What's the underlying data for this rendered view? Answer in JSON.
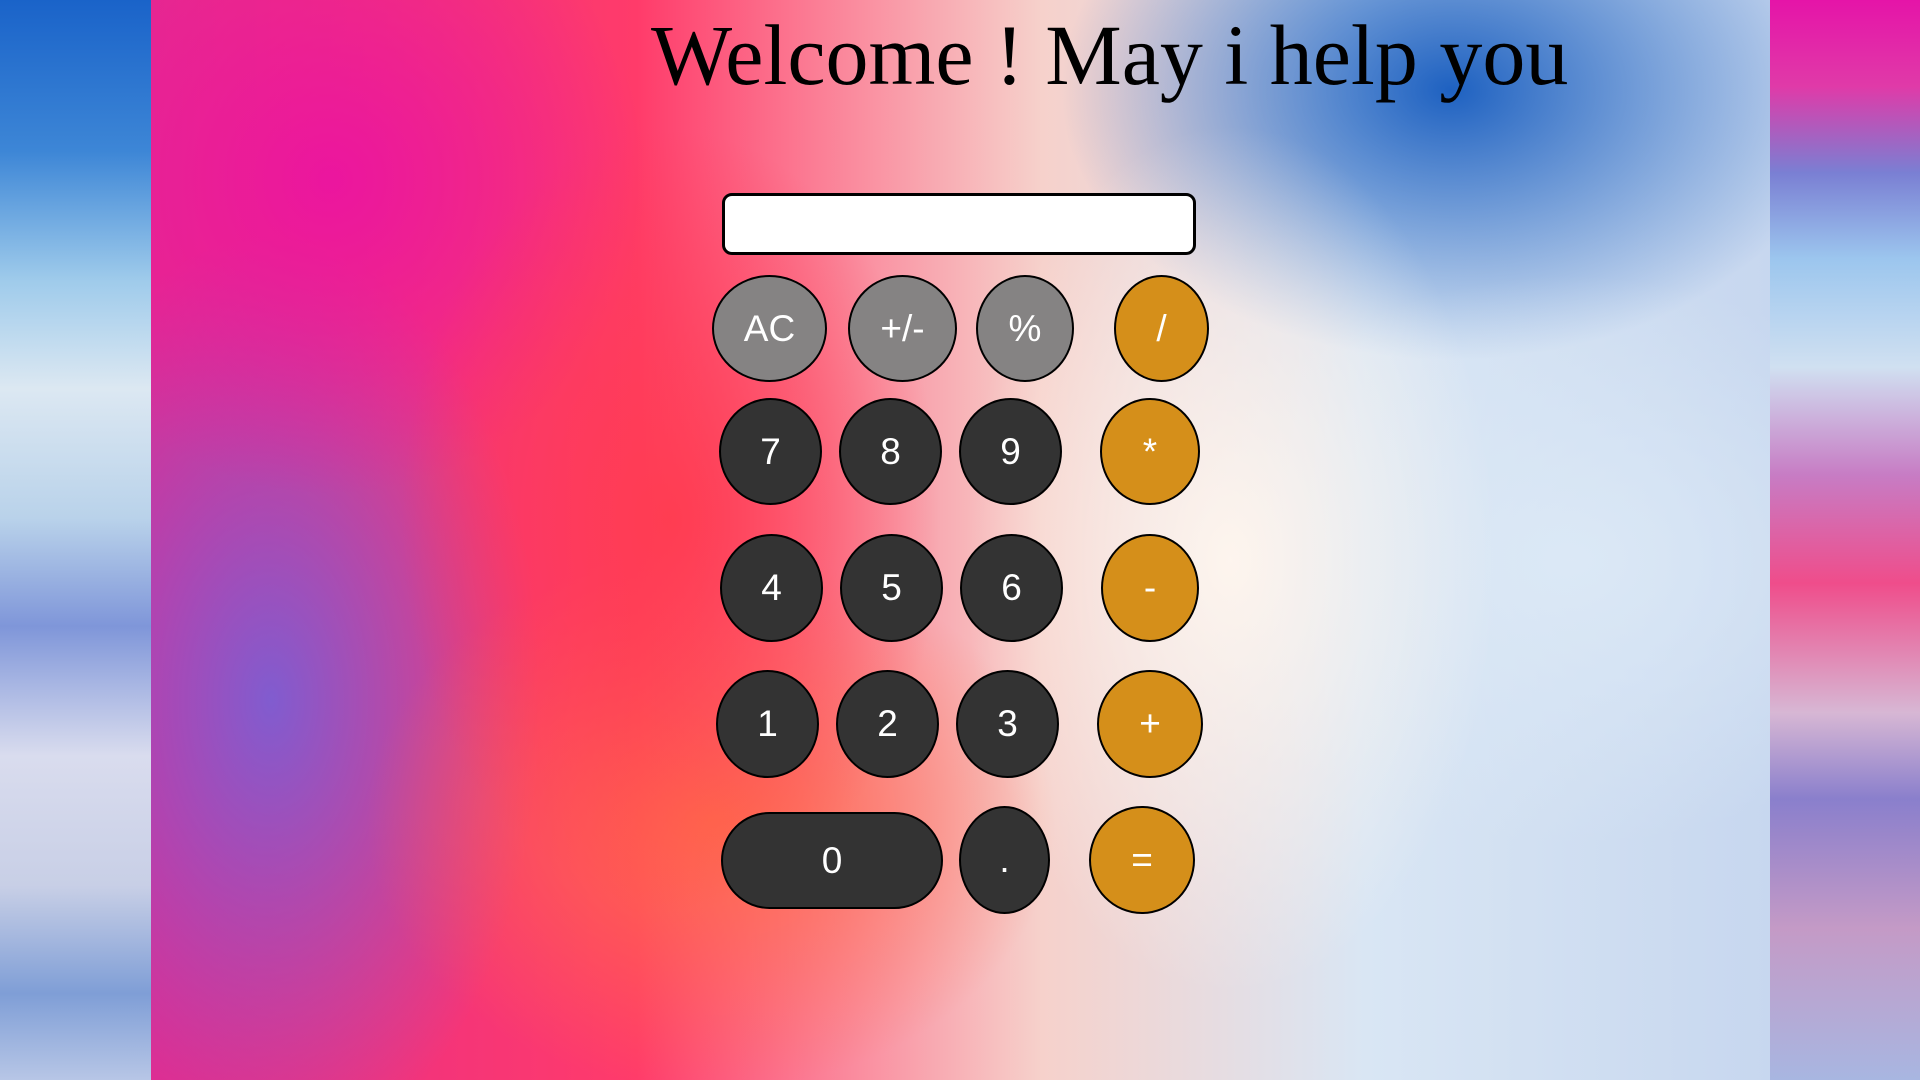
{
  "header": {
    "title": "Welcome ! May i help you"
  },
  "calculator": {
    "display_value": "",
    "buttons": {
      "ac": "AC",
      "plus_minus": "+/-",
      "percent": "%",
      "divide": "/",
      "seven": "7",
      "eight": "8",
      "nine": "9",
      "multiply": "*",
      "four": "4",
      "five": "5",
      "six": "6",
      "minus": "-",
      "one": "1",
      "two": "2",
      "three": "3",
      "plus": "+",
      "zero": "0",
      "decimal": ".",
      "equals": "="
    }
  },
  "colors": {
    "function_key": "#858383",
    "digit_key": "#333333",
    "operator_key": "#d58f1a"
  }
}
